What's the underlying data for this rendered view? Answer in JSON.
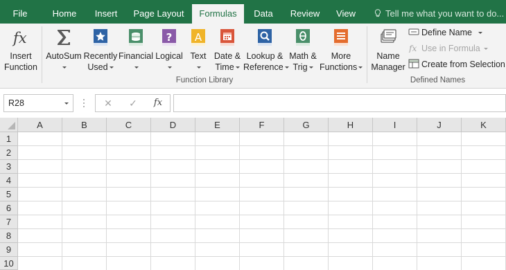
{
  "tabs": [
    {
      "label": "File"
    },
    {
      "label": "Home"
    },
    {
      "label": "Insert"
    },
    {
      "label": "Page Layout"
    },
    {
      "label": "Formulas",
      "active": true
    },
    {
      "label": "Data"
    },
    {
      "label": "Review"
    },
    {
      "label": "View"
    }
  ],
  "tell_me": "Tell me what you want to do...",
  "ribbon": {
    "insert_function": {
      "line1": "Insert",
      "line2": "Function",
      "icon": "fx-icon"
    },
    "autosum": {
      "line1": "AutoSum",
      "icon": "sigma-icon"
    },
    "recently_used": {
      "line1": "Recently",
      "line2": "Used",
      "icon": "star-book-icon"
    },
    "financial": {
      "line1": "Financial",
      "icon": "coins-book-icon"
    },
    "logical": {
      "line1": "Logical",
      "icon": "question-book-icon"
    },
    "text": {
      "line1": "Text",
      "icon": "letter-a-book-icon"
    },
    "date_time": {
      "line1": "Date &",
      "line2": "Time",
      "icon": "calendar-book-icon"
    },
    "lookup_reference": {
      "line1": "Lookup &",
      "line2": "Reference",
      "icon": "magnifier-book-icon"
    },
    "math_trig": {
      "line1": "Math &",
      "line2": "Trig",
      "icon": "theta-book-icon"
    },
    "more_functions": {
      "line1": "More",
      "line2": "Functions",
      "icon": "more-book-icon"
    },
    "function_library_label": "Function Library",
    "name_manager": {
      "line1": "Name",
      "line2": "Manager",
      "icon": "tag-icon"
    },
    "define_name": "Define Name",
    "use_in_formula": "Use in Formula",
    "create_from_selection": "Create from Selection",
    "defined_names_label": "Defined Names"
  },
  "formula_bar": {
    "name_box": "R28",
    "cancel": "✕",
    "enter": "✓",
    "fx": "fx",
    "value": ""
  },
  "grid": {
    "columns": [
      "A",
      "B",
      "C",
      "D",
      "E",
      "F",
      "G",
      "H",
      "I",
      "J",
      "K"
    ],
    "rows": [
      "1",
      "2",
      "3",
      "4",
      "5",
      "6",
      "7",
      "8",
      "9",
      "10"
    ]
  },
  "colors": {
    "accent": "#217346",
    "ribbon_bg": "#f3f3f3",
    "header_bg": "#e6e6e6"
  }
}
